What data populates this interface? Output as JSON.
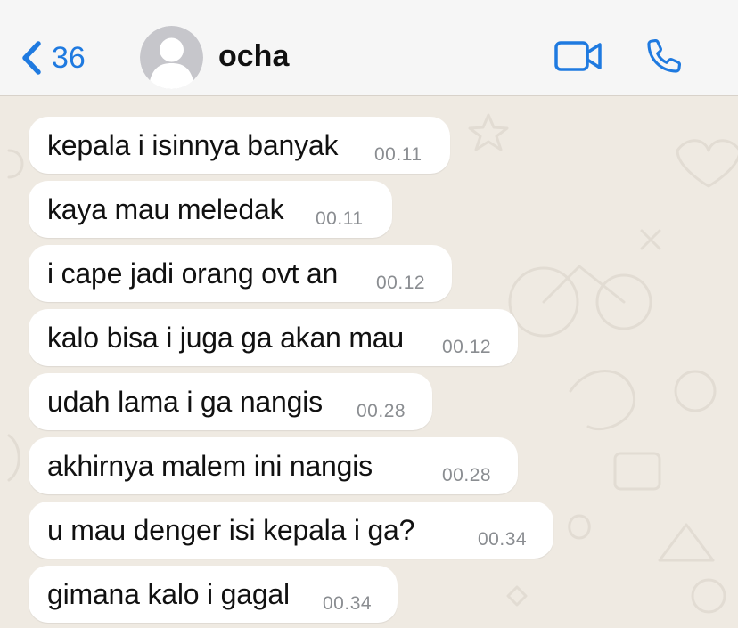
{
  "header": {
    "back_count": "36",
    "contact_name": "ocha",
    "accent_color": "#1f7ae0",
    "icons": [
      "chevron-left-icon",
      "avatar-placeholder-icon",
      "video-camera-icon",
      "phone-icon"
    ]
  },
  "chat": {
    "bubble_color": "#ffffff",
    "wallpaper_color": "#efeae2",
    "messages": [
      {
        "text": "kepala i isinnya banyak",
        "time": "00.11"
      },
      {
        "text": "kaya mau meledak",
        "time": "00.11"
      },
      {
        "text": "i cape jadi orang ovt an",
        "time": "00.12"
      },
      {
        "text": "kalo bisa i juga ga akan mau",
        "time": "00.12"
      },
      {
        "text": "udah lama i ga nangis",
        "time": "00.28"
      },
      {
        "text": "akhirnya malem ini nangis",
        "time": "00.28"
      },
      {
        "text": "u mau denger isi kepala i ga?",
        "time": "00.34"
      },
      {
        "text": "gimana kalo i gagal",
        "time": "00.34"
      }
    ]
  }
}
